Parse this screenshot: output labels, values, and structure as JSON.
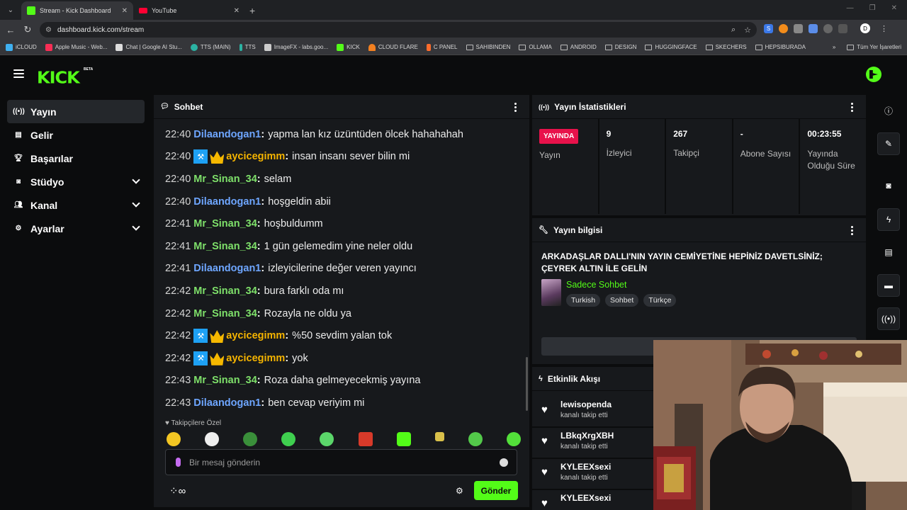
{
  "browser": {
    "tabs": [
      {
        "title": "Stream - Kick Dashboard",
        "active": true
      },
      {
        "title": "YouTube",
        "active": false
      }
    ],
    "url": "dashboard.kick.com/stream",
    "bookmarks": [
      "iCLOUD",
      "Apple Music - Web...",
      "Chat | Google AI Stu...",
      "TTS (MAIN)",
      "TTS",
      "ImageFX - labs.goo...",
      "KICK",
      "CLOUD FLARE",
      "C PANEL",
      "SAHIBINDEN",
      "OLLAMA",
      "ANDROID",
      "DESIGN",
      "HUGGINGFACE",
      "SKECHERS",
      "HEPSIBURADA"
    ],
    "all_bookmarks": "Tüm Yer İşaretleri"
  },
  "kick": {
    "logo": "KICK",
    "beta": "BETA"
  },
  "sidebar": {
    "items": [
      {
        "label": "Yayın",
        "active": true,
        "expandable": false
      },
      {
        "label": "Gelir",
        "active": false,
        "expandable": false
      },
      {
        "label": "Başarılar",
        "active": false,
        "expandable": false
      },
      {
        "label": "Stüdyo",
        "active": false,
        "expandable": true
      },
      {
        "label": "Kanal",
        "active": false,
        "expandable": true
      },
      {
        "label": "Ayarlar",
        "active": false,
        "expandable": true
      }
    ]
  },
  "chat": {
    "title": "Sohbet",
    "messages": [
      {
        "time": "22:40",
        "user": "Dilaandogan1",
        "color": "#6ea6ff",
        "badges": [],
        "text": "yapma lan kız üzüntüden ölcek hahahahah"
      },
      {
        "time": "22:40",
        "user": "aycicegimm",
        "color": "#f5b400",
        "badges": [
          "mod",
          "crown"
        ],
        "text": "insan insanı sever bilin mi"
      },
      {
        "time": "22:40",
        "user": "Mr_Sinan_34",
        "color": "#7ee06a",
        "badges": [],
        "text": "selam"
      },
      {
        "time": "22:40",
        "user": "Dilaandogan1",
        "color": "#6ea6ff",
        "badges": [],
        "text": "hoşgeldin abii"
      },
      {
        "time": "22:41",
        "user": "Mr_Sinan_34",
        "color": "#7ee06a",
        "badges": [],
        "text": "hoşbuldumm"
      },
      {
        "time": "22:41",
        "user": "Mr_Sinan_34",
        "color": "#7ee06a",
        "badges": [],
        "text": "1 gün gelemedim yine neler oldu"
      },
      {
        "time": "22:41",
        "user": "Dilaandogan1",
        "color": "#6ea6ff",
        "badges": [],
        "text": "izleyicilerine değer veren yayıncı"
      },
      {
        "time": "22:42",
        "user": "Mr_Sinan_34",
        "color": "#7ee06a",
        "badges": [],
        "text": "bura farklı oda mı"
      },
      {
        "time": "22:42",
        "user": "Mr_Sinan_34",
        "color": "#7ee06a",
        "badges": [],
        "text": "Rozayla ne oldu ya"
      },
      {
        "time": "22:42",
        "user": "aycicegimm",
        "color": "#f5b400",
        "badges": [
          "mod",
          "crown"
        ],
        "text": "%50 sevdim yalan tok"
      },
      {
        "time": "22:42",
        "user": "aycicegimm",
        "color": "#f5b400",
        "badges": [
          "mod",
          "crown"
        ],
        "text": "yok"
      },
      {
        "time": "22:43",
        "user": "Mr_Sinan_34",
        "color": "#7ee06a",
        "badges": [],
        "text": "Roza daha gelmeyecekmiş yayına"
      },
      {
        "time": "22:43",
        "user": "Dilaandogan1",
        "color": "#6ea6ff",
        "badges": [],
        "text": "ben cevap veriyim mi"
      }
    ],
    "followers_only": "Takipçilere Özel",
    "input_placeholder": "Bir mesaj gönderin",
    "send_label": "Gönder"
  },
  "stats": {
    "title": "Yayın İstatistikleri",
    "live_badge": "YAYINDA",
    "cells": [
      {
        "value": "",
        "label": "Yayın"
      },
      {
        "value": "9",
        "label": "İzleyici"
      },
      {
        "value": "267",
        "label": "Takipçi"
      },
      {
        "value": "-",
        "label": "Abone Sayısı"
      },
      {
        "value": "00:23:55",
        "label": "Yayında Olduğu Süre"
      }
    ]
  },
  "stream_info": {
    "title": "Yayın bilgisi",
    "stream_title": "ARKADAŞLAR DALLI'NIN YAYIN CEMİYETİNE HEPİNİZ DAVETLSİNİZ; ÇEYREK ALTIN İLE GELİN",
    "category": "Sadece Sohbet",
    "tags": [
      "Turkish",
      "Sohbet",
      "Türkçe"
    ]
  },
  "activity": {
    "title": "Etkinlik Akışı",
    "items": [
      {
        "name": "lewisopenda",
        "desc": "kanalı takip etti"
      },
      {
        "name": "LBkqXrgXBH",
        "desc": "kanalı takip etti"
      },
      {
        "name": "KYLEEXsexi",
        "desc": "kanalı takip etti"
      },
      {
        "name": "KYLEEXsexi",
        "desc": ""
      }
    ]
  }
}
